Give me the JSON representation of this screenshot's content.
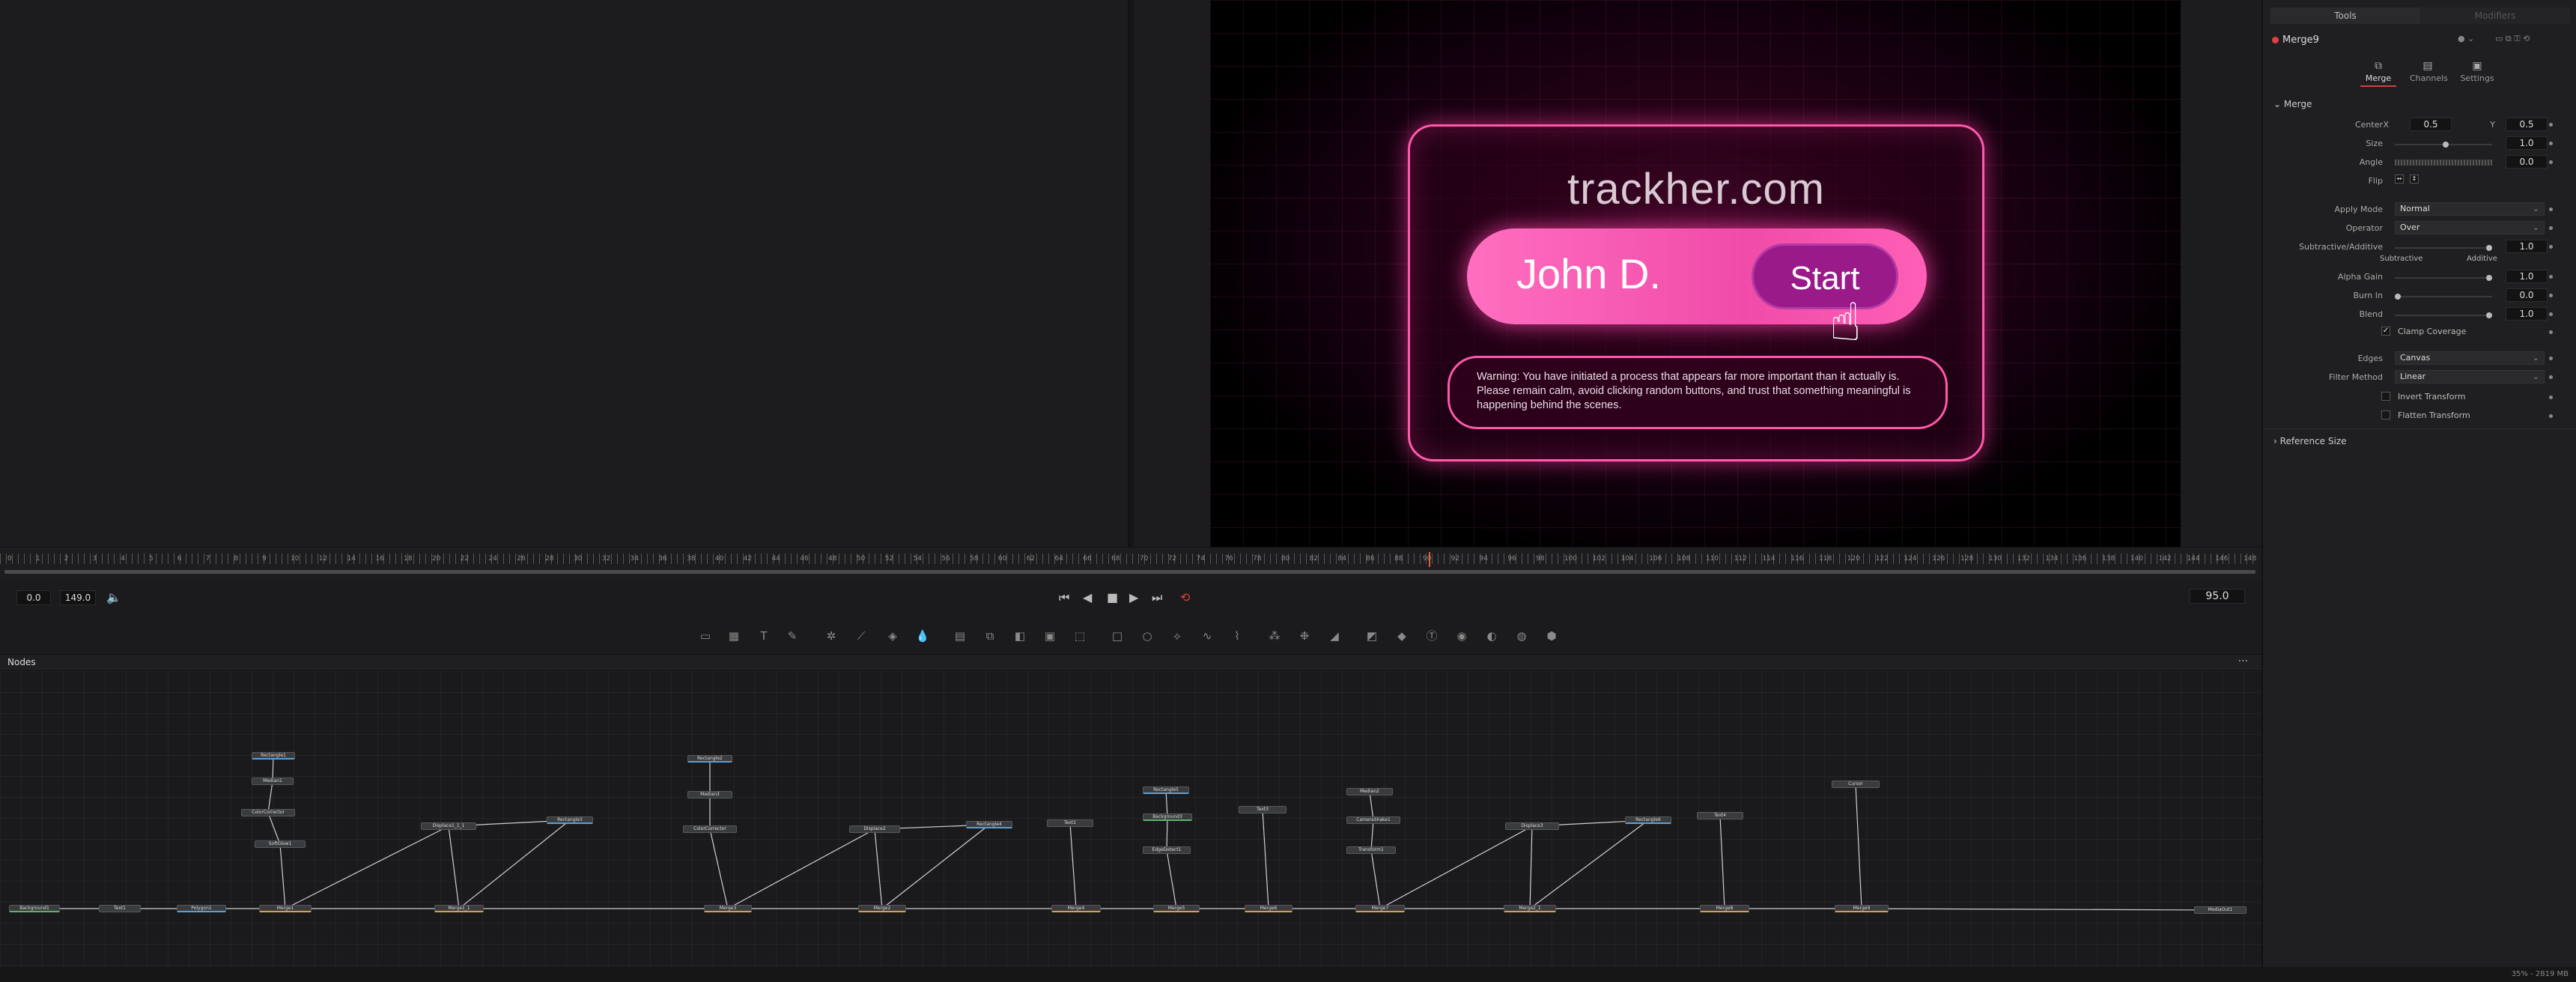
{
  "render": {
    "brand": "trackher.com",
    "name": "John D.",
    "start_label": "Start",
    "warning": "Warning: You have initiated a process that appears far more important than it actually is. Please remain calm, avoid clicking random buttons, and trust that something meaningful is happening behind the scenes."
  },
  "inspector": {
    "tabs": [
      "Tools",
      "Modifiers"
    ],
    "node_name": "Merge9",
    "subtabs": [
      {
        "label": "Merge",
        "icon": "merge-icon"
      },
      {
        "label": "Channels",
        "icon": "channels-icon"
      },
      {
        "label": "Settings",
        "icon": "settings-icon"
      }
    ],
    "section_merge": "Merge",
    "center_label": "Center",
    "x_label": "X",
    "center_x": "0.5",
    "y_label": "Y",
    "center_y": "0.5",
    "size_label": "Size",
    "size_value": "1.0",
    "angle_label": "Angle",
    "angle_value": "0.0",
    "flip_label": "Flip",
    "apply_mode_label": "Apply Mode",
    "apply_mode_value": "Normal",
    "operator_label": "Operator",
    "operator_value": "Over",
    "subadd_label": "Subtractive/Additive",
    "subadd_value": "1.0",
    "subtractive_label": "Subtractive",
    "additive_label": "Additive",
    "alpha_gain_label": "Alpha Gain",
    "alpha_gain_value": "1.0",
    "burn_in_label": "Burn In",
    "burn_in_value": "0.0",
    "blend_label": "Blend",
    "blend_value": "1.0",
    "clamp_label": "Clamp Coverage",
    "edges_label": "Edges",
    "edges_value": "Canvas",
    "filter_label": "Filter Method",
    "filter_value": "Linear",
    "invert_label": "Invert Transform",
    "flatten_label": "Flatten Transform",
    "section_reference": "Reference Size"
  },
  "timeline": {
    "ruler_labels": [
      "0",
      "1",
      "2",
      "3",
      "4",
      "5",
      "6",
      "7",
      "8",
      "9",
      "10",
      "12",
      "14",
      "16",
      "18",
      "20",
      "22",
      "24",
      "26",
      "28",
      "30",
      "32",
      "34",
      "36",
      "38",
      "40",
      "42",
      "44",
      "46",
      "48",
      "50",
      "52",
      "54",
      "56",
      "58",
      "60",
      "62",
      "64",
      "66",
      "68",
      "70",
      "72",
      "74",
      "76",
      "78",
      "80",
      "82",
      "84",
      "86",
      "88",
      "90",
      "92",
      "94",
      "96",
      "98",
      "100",
      "102",
      "104",
      "106",
      "108",
      "110",
      "112",
      "114",
      "116",
      "118",
      "120",
      "122",
      "124",
      "126",
      "128",
      "130",
      "132",
      "134",
      "136",
      "138",
      "140",
      "142",
      "144",
      "146",
      "148"
    ],
    "start_time": "0.0",
    "end_time": "149.0",
    "current_frame": "95.0"
  },
  "nodes_panel": {
    "title": "Nodes",
    "more": "···",
    "items": [
      {
        "name": "Background1",
        "kind": "bg"
      },
      {
        "name": "Text1",
        "kind": "plain"
      },
      {
        "name": "Polygon1",
        "kind": "mask"
      },
      {
        "name": "Rectangle1",
        "kind": "mask"
      },
      {
        "name": "Median1",
        "kind": "plain"
      },
      {
        "name": "ColorCorrector",
        "kind": "plain"
      },
      {
        "name": "SoftGlow1",
        "kind": "plain"
      },
      {
        "name": "Merge1",
        "kind": "merge"
      },
      {
        "name": "Displace1_1_1",
        "kind": "plain"
      },
      {
        "name": "Rectangle3",
        "kind": "mask"
      },
      {
        "name": "Merge1_1",
        "kind": "merge"
      },
      {
        "name": "Rectangle2",
        "kind": "mask"
      },
      {
        "name": "Median3",
        "kind": "plain"
      },
      {
        "name": "ColorCorrector",
        "kind": "plain"
      },
      {
        "name": "Merge3",
        "kind": "merge"
      },
      {
        "name": "Displace2",
        "kind": "plain"
      },
      {
        "name": "Rectangle4",
        "kind": "mask"
      },
      {
        "name": "Merge2",
        "kind": "merge"
      },
      {
        "name": "Text2",
        "kind": "plain"
      },
      {
        "name": "Merge4",
        "kind": "merge"
      },
      {
        "name": "Rectangle5",
        "kind": "mask"
      },
      {
        "name": "Background3",
        "kind": "bg"
      },
      {
        "name": "EdgeDetect1",
        "kind": "plain"
      },
      {
        "name": "Merge5",
        "kind": "merge"
      },
      {
        "name": "Text3",
        "kind": "plain"
      },
      {
        "name": "Merge6",
        "kind": "merge"
      },
      {
        "name": "Median2",
        "kind": "plain"
      },
      {
        "name": "CameraShake1",
        "kind": "plain"
      },
      {
        "name": "Transform1",
        "kind": "plain"
      },
      {
        "name": "Merge7",
        "kind": "merge"
      },
      {
        "name": "Displace3",
        "kind": "plain"
      },
      {
        "name": "Rectangle6",
        "kind": "mask"
      },
      {
        "name": "Merge2_1",
        "kind": "merge"
      },
      {
        "name": "Text4",
        "kind": "plain"
      },
      {
        "name": "Merge8",
        "kind": "merge"
      },
      {
        "name": "Cursor",
        "kind": "plain"
      },
      {
        "name": "Merge9",
        "kind": "merge"
      },
      {
        "name": "MediaOut1",
        "kind": "plain"
      }
    ]
  },
  "status": {
    "memory": "35% - 2819 MB"
  },
  "colors": {
    "accent_pink": "#ff5aaa",
    "start_button": "#9a1a8a",
    "merge_node": "#d6a43a",
    "mask_node": "#5aa0d6",
    "bg_node": "#59b46a",
    "playhead": "#e06030"
  }
}
